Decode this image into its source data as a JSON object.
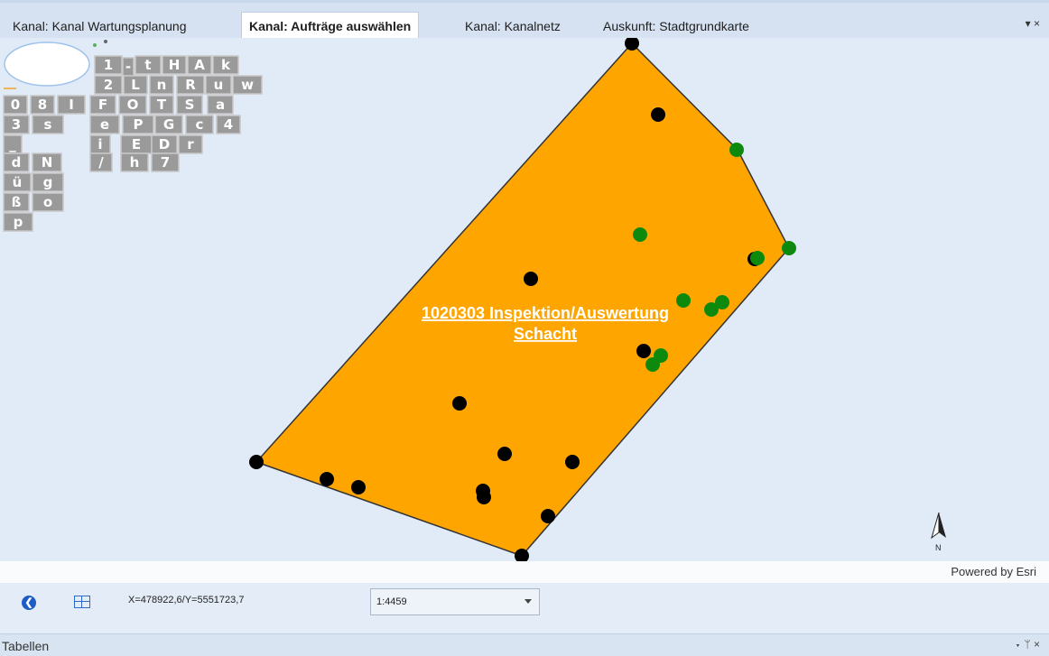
{
  "tabs": [
    {
      "label": "Kanal: Kanal Wartungsplanung"
    },
    {
      "label": "Kanal: Aufträge auswählen"
    },
    {
      "label": "Kanal: Kanalnetz"
    },
    {
      "label": "Auskunft: Stadtgrundkarte"
    }
  ],
  "tab_controls": "▾ ×",
  "map": {
    "polygon_label_line1": "1020303 Inspektion/Auswertung",
    "polygon_label_line2": "Schacht",
    "north_label": "N",
    "fill_color": "#ffa500",
    "black_point_color": "#000000",
    "green_point_color": "#0d8a0d"
  },
  "cluster_tiles": [
    "1",
    "-",
    "t",
    "H",
    "A",
    "k",
    "2",
    "L",
    "n",
    "R",
    "u",
    "w",
    "0",
    "8",
    "I",
    "F",
    "O",
    "T",
    "S",
    "a",
    "3",
    "s",
    "e",
    "P",
    "G",
    "c",
    "4",
    "_",
    "i",
    "E",
    "D",
    "r",
    "d",
    "N",
    "/",
    "h",
    "7",
    "ü",
    "g",
    "ß",
    "o",
    "p"
  ],
  "powered_by": "Powered by Esri",
  "status": {
    "coordinates": "X=478922,6/Y=5551723,7",
    "scale": "1:4459"
  },
  "bottom_panel": {
    "title": "Tabellen",
    "controls": "▾ ᛘ ×"
  }
}
